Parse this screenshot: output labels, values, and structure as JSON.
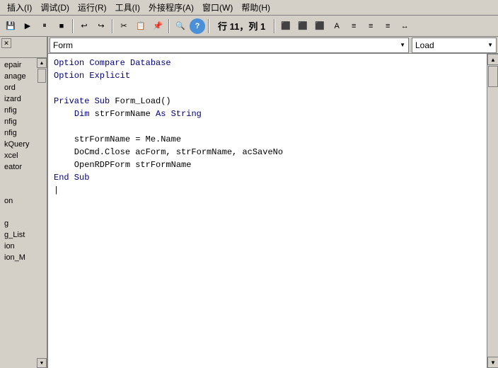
{
  "menubar": {
    "items": [
      {
        "label": "插入(I)",
        "id": "insert"
      },
      {
        "label": "调试(D)",
        "id": "debug"
      },
      {
        "label": "运行(R)",
        "id": "run"
      },
      {
        "label": "工具(I)",
        "id": "tools"
      },
      {
        "label": "外接程序(A)",
        "id": "addins"
      },
      {
        "label": "窗口(W)",
        "id": "window"
      },
      {
        "label": "帮助(H)",
        "id": "help"
      }
    ]
  },
  "toolbar": {
    "position_text": "行 11，列 1"
  },
  "editor_header": {
    "form_dropdown": "Form",
    "load_dropdown": "Load"
  },
  "code": {
    "lines": [
      {
        "indent": 0,
        "content": "Option Compare Database",
        "type": "keyword_line"
      },
      {
        "indent": 0,
        "content": "Option Explicit",
        "type": "keyword_line"
      },
      {
        "indent": 0,
        "content": "",
        "type": "empty"
      },
      {
        "indent": 0,
        "content": "Private Sub Form_Load()",
        "type": "sub"
      },
      {
        "indent": 1,
        "content": "    Dim strFormName As String",
        "type": "dim"
      },
      {
        "indent": 0,
        "content": "",
        "type": "empty"
      },
      {
        "indent": 1,
        "content": "    strFormName = Me.Name",
        "type": "code"
      },
      {
        "indent": 1,
        "content": "    DoCmd.Close acForm, strFormName, acSaveNo",
        "type": "code"
      },
      {
        "indent": 1,
        "content": "    OpenRDPForm strFormName",
        "type": "code"
      },
      {
        "indent": 0,
        "content": "End Sub",
        "type": "endsub"
      },
      {
        "indent": 0,
        "content": "",
        "type": "cursor"
      }
    ]
  },
  "sidebar": {
    "items": [
      {
        "label": "epair"
      },
      {
        "label": "anage"
      },
      {
        "label": "ord"
      },
      {
        "label": "izard"
      },
      {
        "label": "nfig"
      },
      {
        "label": "nfig"
      },
      {
        "label": "nfig"
      },
      {
        "label": "kQuery"
      },
      {
        "label": "xcel"
      },
      {
        "label": "eator"
      },
      {
        "label": ""
      },
      {
        "label": ""
      },
      {
        "label": "on"
      },
      {
        "label": ""
      },
      {
        "label": "g"
      },
      {
        "label": "g_List"
      },
      {
        "label": "ion"
      },
      {
        "label": "ion_M"
      },
      {
        "label": "..."
      }
    ]
  }
}
